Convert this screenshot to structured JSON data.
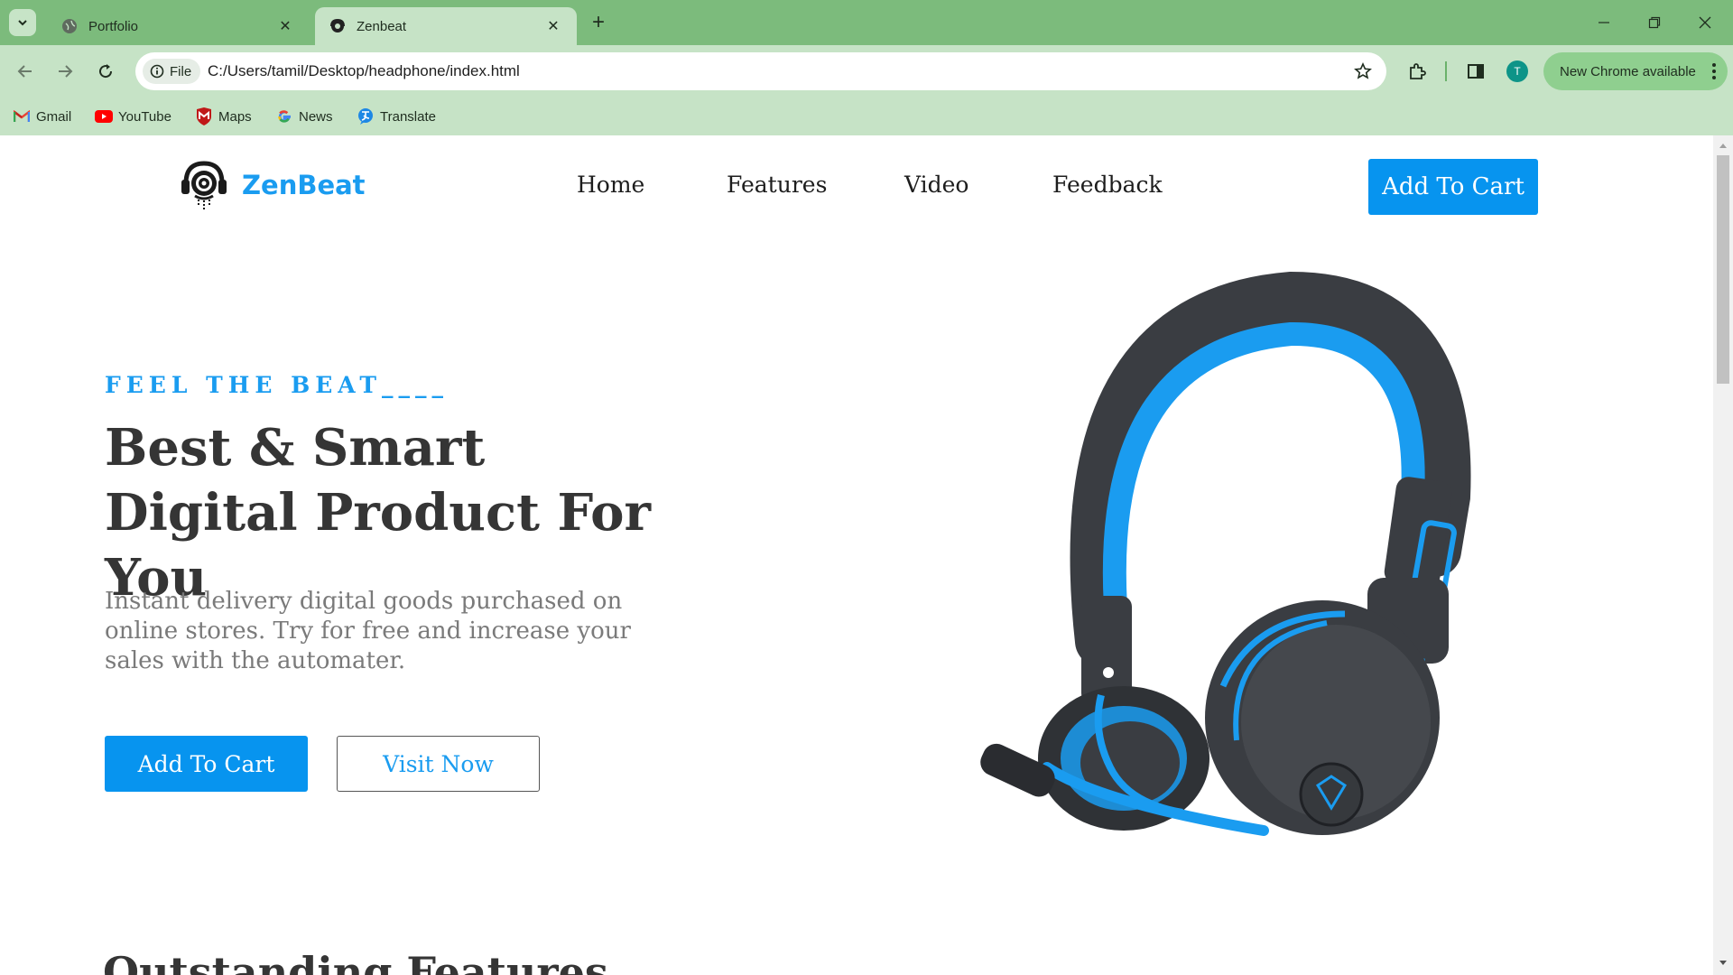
{
  "browser": {
    "tabs": [
      {
        "title": "Portfolio",
        "active": false
      },
      {
        "title": "Zenbeat",
        "active": true
      }
    ],
    "address": {
      "chip_label": "File",
      "url": "C:/Users/tamil/Desktop/headphone/index.html"
    },
    "profile_initial": "T",
    "update_label": "New Chrome available",
    "bookmarks": [
      "Gmail",
      "YouTube",
      "Maps",
      "News",
      "Translate"
    ],
    "colors": {
      "frame": "#7cbb7c",
      "toolbar": "#c6e3c6"
    }
  },
  "site": {
    "brand": "ZenBeat",
    "nav": [
      "Home",
      "Features",
      "Video",
      "Feedback"
    ],
    "header_cta": "Add To Cart",
    "hero": {
      "tagline": "FEEL THE BEAT____",
      "headline": "Best & Smart Digital Product For You",
      "description": "Instant delivery digital goods purchased on online stores. Try for free and increase your sales with the automater.",
      "primary_button": "Add To Cart",
      "secondary_button": "Visit Now"
    },
    "next_section_title": "Outstanding Features",
    "colors": {
      "accent": "#0794ef",
      "heading": "#353535",
      "body_text": "#7a7a7a",
      "product_blue": "#1a9cf0",
      "product_dark": "#3a3d42"
    }
  }
}
